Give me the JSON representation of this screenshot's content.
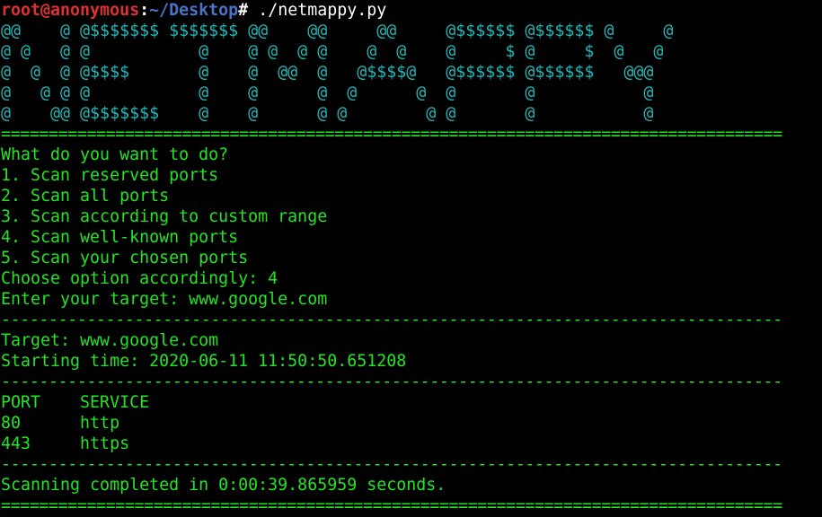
{
  "prompt": {
    "user_host": "root@anonymous",
    "separator": ":",
    "path": "~/Desktop",
    "symbol": "#",
    "command": " ./netmappy.py"
  },
  "banner": [
    "@@    @ @$$$$$$$ $$$$$$$ @@    @@     @@     @$$$$$$ @$$$$$$ @     @",
    "@ @   @ @           @    @ @  @ @    @  @    @     $ @     $  @   @",
    "@  @  @ @$$$$       @    @  @@  @   @$$$$@   @$$$$$$ @$$$$$$   @@@",
    "@   @ @ @           @    @      @  @      @  @       @           @",
    "@    @@ @$$$$$$$    @    @      @ @        @ @       @           @"
  ],
  "dividers": {
    "double": "==================================================================================",
    "single": "----------------------------------------------------------------------------------"
  },
  "menu": {
    "question": "What do you want to do?",
    "options": [
      "1. Scan reserved ports",
      "2. Scan all ports",
      "3. Scan according to custom range",
      "4. Scan well-known ports",
      "5. Scan your chosen ports"
    ],
    "choice_line": "Choose option accordingly: 4",
    "target_line": "Enter your target: www.google.com"
  },
  "scan": {
    "target_line": "Target: www.google.com",
    "start_line": "Starting time: 2020-06-11 11:50:50.651208"
  },
  "results": {
    "header": "PORT    SERVICE",
    "rows": [
      "80      http",
      "443     https"
    ]
  },
  "footer": {
    "completed_line": "Scanning completed in 0:00:39.865959 seconds."
  }
}
